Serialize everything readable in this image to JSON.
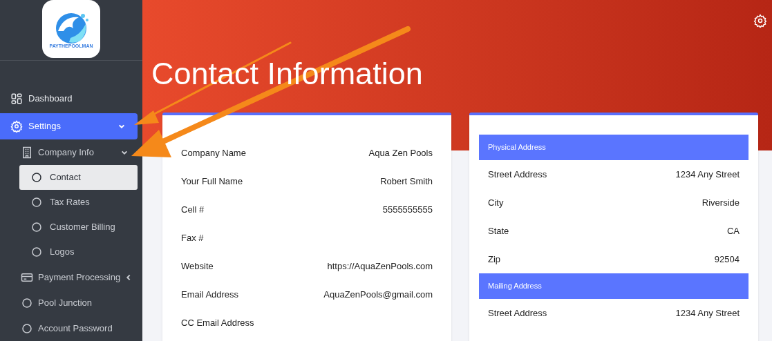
{
  "sidebar": {
    "logo_text": "PAYTHEPOOLMAN",
    "items": [
      {
        "label": "Dashboard",
        "kind": "grid",
        "selected": false
      },
      {
        "label": "Settings",
        "kind": "gear",
        "selected": true,
        "expanded": true,
        "children": [
          {
            "label": "Company Info",
            "kind": "building",
            "selected": false,
            "expanded": true,
            "children": [
              {
                "label": "Contact",
                "kind": "circle",
                "selected": true
              },
              {
                "label": "Tax Rates",
                "kind": "circle",
                "selected": false
              },
              {
                "label": "Customer Billing",
                "kind": "circle",
                "selected": false
              },
              {
                "label": "Logos",
                "kind": "circle",
                "selected": false
              }
            ]
          },
          {
            "label": "Payment Processing",
            "kind": "card",
            "selected": false,
            "expanded": false
          },
          {
            "label": "Pool Junction",
            "kind": "circle",
            "selected": false
          },
          {
            "label": "Account Password",
            "kind": "circle",
            "selected": false
          }
        ]
      }
    ]
  },
  "header": {
    "title": "Contact Information"
  },
  "contact_card": {
    "rows": [
      {
        "label": "Company Name",
        "value": "Aqua Zen Pools"
      },
      {
        "label": "Your Full Name",
        "value": "Robert Smith"
      },
      {
        "label": "Cell #",
        "value": "5555555555"
      },
      {
        "label": "Fax #"
      },
      {
        "label": "Website",
        "value": "https://AquaZenPools.com"
      },
      {
        "label": "Email Address",
        "value": "AquaZenPools@gmail.com"
      },
      {
        "label": "CC Email Address"
      }
    ]
  },
  "address_card": {
    "sections": [
      {
        "title": "Physical Address",
        "rows": [
          {
            "label": "Street Address",
            "value": "1234 Any Street"
          },
          {
            "label": "City",
            "value": "Riverside"
          },
          {
            "label": "State",
            "value": "CA"
          },
          {
            "label": "Zip",
            "value": "92504"
          }
        ]
      },
      {
        "title": "Mailing Address",
        "rows": [
          {
            "label": "Street Address",
            "value": "1234 Any Street"
          }
        ]
      }
    ]
  }
}
